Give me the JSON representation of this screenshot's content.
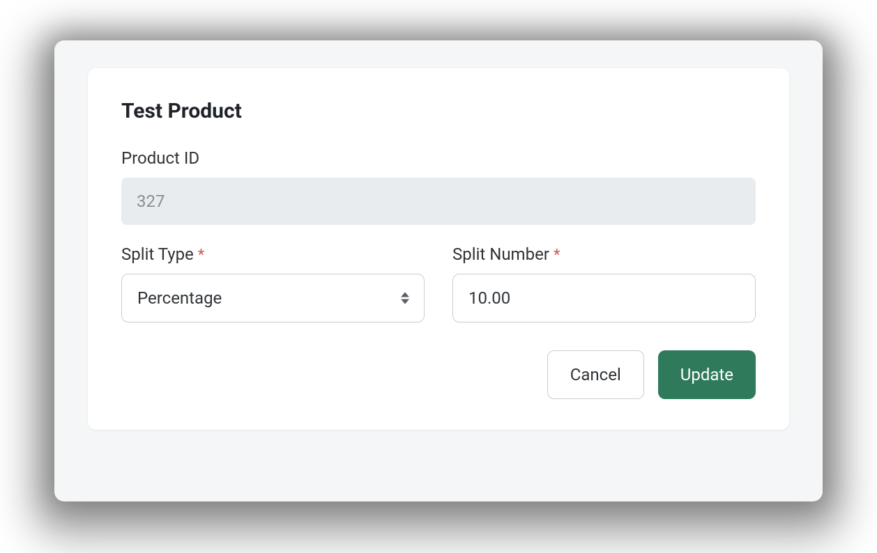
{
  "card": {
    "title": "Test Product",
    "product_id": {
      "label": "Product ID",
      "value": "327"
    },
    "split_type": {
      "label": "Split Type",
      "required_mark": "*",
      "value": "Percentage"
    },
    "split_number": {
      "label": "Split Number",
      "required_mark": "*",
      "value": "10.00"
    },
    "actions": {
      "cancel": "Cancel",
      "update": "Update"
    }
  },
  "colors": {
    "primary": "#2f7a5a",
    "panel_bg": "#f5f6f7",
    "disabled_bg": "#e9ecef",
    "border": "#c9ccd0",
    "required": "#d9534f"
  }
}
